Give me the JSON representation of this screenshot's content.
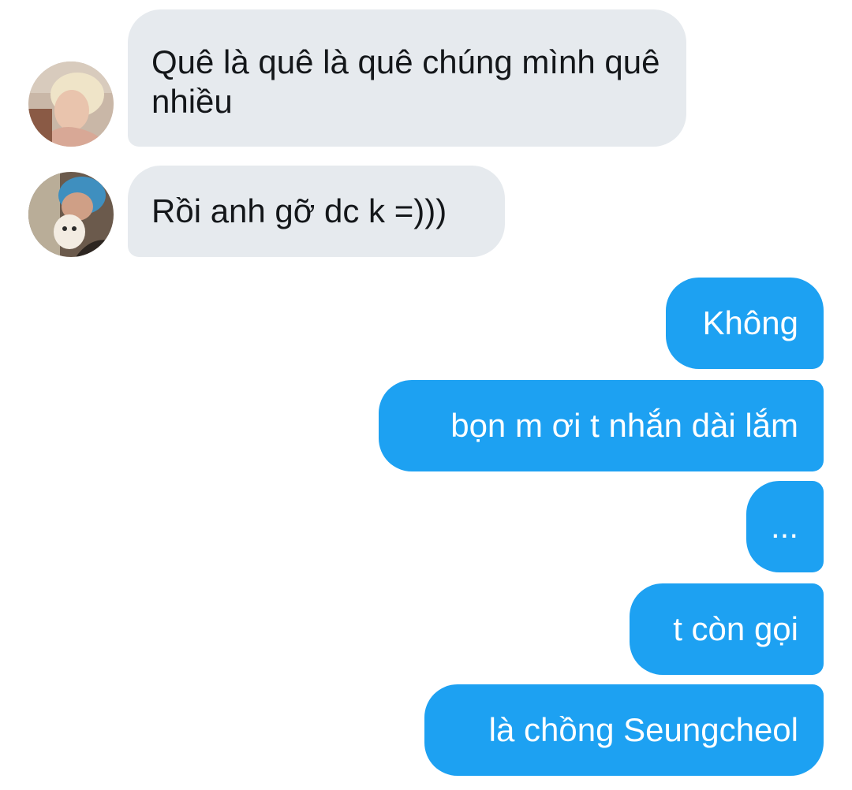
{
  "conversation": {
    "incoming": [
      {
        "sender_avatar": "blonde-person-profile-avatar",
        "text": "Quê là quê là quê chúng mình quê nhiều"
      },
      {
        "sender_avatar": "blue-hair-person-with-dog-avatar",
        "text": "Rồi anh gỡ dc k =)))"
      }
    ],
    "outgoing": [
      {
        "text": "Không"
      },
      {
        "text": "bọn m ơi t nhắn dài lắm"
      },
      {
        "text": "..."
      },
      {
        "text": "t còn gọi"
      },
      {
        "text": "là chồng Seungcheol"
      }
    ]
  },
  "colors": {
    "incoming_bubble": "#e6eaee",
    "incoming_text": "#14171a",
    "outgoing_bubble": "#1da1f2",
    "outgoing_text": "#ffffff",
    "background": "#ffffff"
  }
}
